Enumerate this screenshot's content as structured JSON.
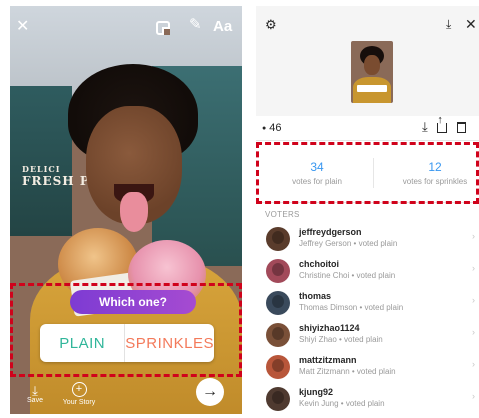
{
  "story_composer": {
    "toolbar": {
      "close_icon": "close-icon",
      "sticker_icon": "sticker-icon",
      "draw_icon": "pen-icon",
      "text_tool_label": "Aa"
    },
    "background_sign": {
      "line1": "DELICI",
      "line2": "FRESH PIES"
    },
    "poll_sticker": {
      "question": "Which one?",
      "options": [
        "PLAIN",
        "SPRINKLES"
      ],
      "colors": {
        "question_gradient": [
          "#7d3bd3",
          "#a64bd1"
        ],
        "option_plain": "#30b69a",
        "option_sprinkles": "#f37a5b"
      }
    },
    "bottom_bar": {
      "save_label": "Save",
      "your_story_label": "Your Story",
      "send_icon": "arrow-right-icon"
    }
  },
  "poll_results": {
    "header": {
      "settings_icon": "gear-icon",
      "download_icon": "download-history-icon",
      "close_icon": "close-icon"
    },
    "view_count": "46",
    "action_icons": [
      "download-icon",
      "share-icon",
      "trash-icon"
    ],
    "votes": [
      {
        "count": "34",
        "label": "votes for plain"
      },
      {
        "count": "12",
        "label": "votes for sprinkles"
      }
    ],
    "voters_heading": "VOTERS",
    "voters": [
      {
        "username": "jeffreydgerson",
        "detail": "Jeffrey Gerson • voted plain"
      },
      {
        "username": "chchoitoi",
        "detail": "Christine Choi • voted plain"
      },
      {
        "username": "thomas",
        "detail": "Thomas Dimson • voted plain"
      },
      {
        "username": "shiyizhao1124",
        "detail": "Shiyi Zhao • voted plain"
      },
      {
        "username": "mattzitzmann",
        "detail": "Matt Zitzmann • voted plain"
      },
      {
        "username": "kjung92",
        "detail": "Kevin Jung • voted plain"
      }
    ],
    "accent_color": "#3897f0"
  },
  "annotation_color": "#d0021b"
}
